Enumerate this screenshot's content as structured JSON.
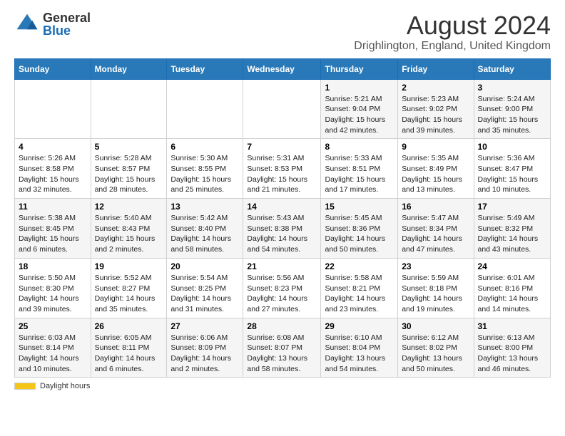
{
  "logo": {
    "general": "General",
    "blue": "Blue"
  },
  "title": "August 2024",
  "subtitle": "Drighlington, England, United Kingdom",
  "days_of_week": [
    "Sunday",
    "Monday",
    "Tuesday",
    "Wednesday",
    "Thursday",
    "Friday",
    "Saturday"
  ],
  "weeks": [
    [
      {
        "num": "",
        "info": ""
      },
      {
        "num": "",
        "info": ""
      },
      {
        "num": "",
        "info": ""
      },
      {
        "num": "",
        "info": ""
      },
      {
        "num": "1",
        "info": "Sunrise: 5:21 AM\nSunset: 9:04 PM\nDaylight: 15 hours and 42 minutes."
      },
      {
        "num": "2",
        "info": "Sunrise: 5:23 AM\nSunset: 9:02 PM\nDaylight: 15 hours and 39 minutes."
      },
      {
        "num": "3",
        "info": "Sunrise: 5:24 AM\nSunset: 9:00 PM\nDaylight: 15 hours and 35 minutes."
      }
    ],
    [
      {
        "num": "4",
        "info": "Sunrise: 5:26 AM\nSunset: 8:58 PM\nDaylight: 15 hours and 32 minutes."
      },
      {
        "num": "5",
        "info": "Sunrise: 5:28 AM\nSunset: 8:57 PM\nDaylight: 15 hours and 28 minutes."
      },
      {
        "num": "6",
        "info": "Sunrise: 5:30 AM\nSunset: 8:55 PM\nDaylight: 15 hours and 25 minutes."
      },
      {
        "num": "7",
        "info": "Sunrise: 5:31 AM\nSunset: 8:53 PM\nDaylight: 15 hours and 21 minutes."
      },
      {
        "num": "8",
        "info": "Sunrise: 5:33 AM\nSunset: 8:51 PM\nDaylight: 15 hours and 17 minutes."
      },
      {
        "num": "9",
        "info": "Sunrise: 5:35 AM\nSunset: 8:49 PM\nDaylight: 15 hours and 13 minutes."
      },
      {
        "num": "10",
        "info": "Sunrise: 5:36 AM\nSunset: 8:47 PM\nDaylight: 15 hours and 10 minutes."
      }
    ],
    [
      {
        "num": "11",
        "info": "Sunrise: 5:38 AM\nSunset: 8:45 PM\nDaylight: 15 hours and 6 minutes."
      },
      {
        "num": "12",
        "info": "Sunrise: 5:40 AM\nSunset: 8:43 PM\nDaylight: 15 hours and 2 minutes."
      },
      {
        "num": "13",
        "info": "Sunrise: 5:42 AM\nSunset: 8:40 PM\nDaylight: 14 hours and 58 minutes."
      },
      {
        "num": "14",
        "info": "Sunrise: 5:43 AM\nSunset: 8:38 PM\nDaylight: 14 hours and 54 minutes."
      },
      {
        "num": "15",
        "info": "Sunrise: 5:45 AM\nSunset: 8:36 PM\nDaylight: 14 hours and 50 minutes."
      },
      {
        "num": "16",
        "info": "Sunrise: 5:47 AM\nSunset: 8:34 PM\nDaylight: 14 hours and 47 minutes."
      },
      {
        "num": "17",
        "info": "Sunrise: 5:49 AM\nSunset: 8:32 PM\nDaylight: 14 hours and 43 minutes."
      }
    ],
    [
      {
        "num": "18",
        "info": "Sunrise: 5:50 AM\nSunset: 8:30 PM\nDaylight: 14 hours and 39 minutes."
      },
      {
        "num": "19",
        "info": "Sunrise: 5:52 AM\nSunset: 8:27 PM\nDaylight: 14 hours and 35 minutes."
      },
      {
        "num": "20",
        "info": "Sunrise: 5:54 AM\nSunset: 8:25 PM\nDaylight: 14 hours and 31 minutes."
      },
      {
        "num": "21",
        "info": "Sunrise: 5:56 AM\nSunset: 8:23 PM\nDaylight: 14 hours and 27 minutes."
      },
      {
        "num": "22",
        "info": "Sunrise: 5:58 AM\nSunset: 8:21 PM\nDaylight: 14 hours and 23 minutes."
      },
      {
        "num": "23",
        "info": "Sunrise: 5:59 AM\nSunset: 8:18 PM\nDaylight: 14 hours and 19 minutes."
      },
      {
        "num": "24",
        "info": "Sunrise: 6:01 AM\nSunset: 8:16 PM\nDaylight: 14 hours and 14 minutes."
      }
    ],
    [
      {
        "num": "25",
        "info": "Sunrise: 6:03 AM\nSunset: 8:14 PM\nDaylight: 14 hours and 10 minutes."
      },
      {
        "num": "26",
        "info": "Sunrise: 6:05 AM\nSunset: 8:11 PM\nDaylight: 14 hours and 6 minutes."
      },
      {
        "num": "27",
        "info": "Sunrise: 6:06 AM\nSunset: 8:09 PM\nDaylight: 14 hours and 2 minutes."
      },
      {
        "num": "28",
        "info": "Sunrise: 6:08 AM\nSunset: 8:07 PM\nDaylight: 13 hours and 58 minutes."
      },
      {
        "num": "29",
        "info": "Sunrise: 6:10 AM\nSunset: 8:04 PM\nDaylight: 13 hours and 54 minutes."
      },
      {
        "num": "30",
        "info": "Sunrise: 6:12 AM\nSunset: 8:02 PM\nDaylight: 13 hours and 50 minutes."
      },
      {
        "num": "31",
        "info": "Sunrise: 6:13 AM\nSunset: 8:00 PM\nDaylight: 13 hours and 46 minutes."
      }
    ]
  ],
  "footer": {
    "daylight_label": "Daylight hours"
  }
}
